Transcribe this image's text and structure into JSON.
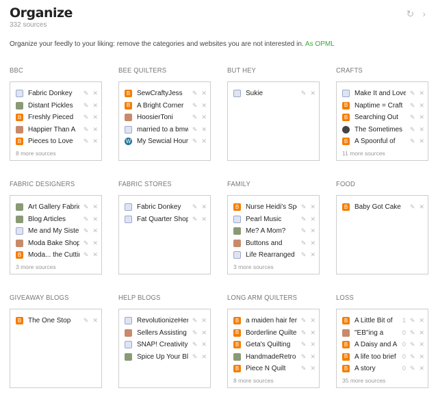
{
  "header": {
    "title": "Organize",
    "count": "332 sources"
  },
  "intro": {
    "text": "Organize your feedly to your liking: remove the categories and websites you are not interested in.",
    "opml": "As OPML"
  },
  "icons": {
    "refresh": "refresh-icon",
    "next": "chevron-right-icon"
  },
  "categories": [
    {
      "name": "BBC",
      "sources": [
        {
          "name": "Fabric Donkey",
          "icon": "generic"
        },
        {
          "name": "Distant Pickles",
          "icon": "img"
        },
        {
          "name": "Freshly Pieced",
          "icon": "blogger"
        },
        {
          "name": "Happier Than A",
          "icon": "img2"
        },
        {
          "name": "Pieces to Love",
          "icon": "blogger"
        }
      ],
      "more": "8 more sources"
    },
    {
      "name": "BEE QUILTERS",
      "sources": [
        {
          "name": "SewCraftyJess",
          "icon": "blogger"
        },
        {
          "name": "A Bright Corner",
          "icon": "blogger"
        },
        {
          "name": "HoosierToni",
          "icon": "img2"
        },
        {
          "name": "married to a bmw",
          "icon": "generic"
        },
        {
          "name": "My Sewcial Hour",
          "icon": "wp"
        }
      ],
      "more": ""
    },
    {
      "name": "BUT HEY",
      "sources": [
        {
          "name": "Sukie",
          "icon": "generic"
        }
      ],
      "more": ""
    },
    {
      "name": "CRAFTS",
      "sources": [
        {
          "name": "Make It and Love It",
          "icon": "generic"
        },
        {
          "name": "Naptime = Craft",
          "icon": "blogger"
        },
        {
          "name": "Searching Out",
          "icon": "blogger"
        },
        {
          "name": "The Sometimes",
          "icon": "dark"
        },
        {
          "name": "A Spoonful of",
          "icon": "blogger"
        }
      ],
      "more": "11 more sources"
    },
    {
      "name": "FABRIC DESIGNERS",
      "sources": [
        {
          "name": "Art Gallery Fabrics",
          "icon": "img"
        },
        {
          "name": "Blog Articles",
          "icon": "img"
        },
        {
          "name": "Me and My Sister",
          "icon": "generic"
        },
        {
          "name": "Moda Bake Shop",
          "icon": "img2"
        },
        {
          "name": "Moda... the Cutting",
          "icon": "blogger"
        }
      ],
      "more": "3 more sources"
    },
    {
      "name": "FABRIC STORES",
      "sources": [
        {
          "name": "Fabric Donkey",
          "icon": "generic"
        },
        {
          "name": "Fat Quarter Shop's",
          "icon": "generic"
        }
      ],
      "more": ""
    },
    {
      "name": "FAMILY",
      "sources": [
        {
          "name": "Nurse Heidi's Spot",
          "icon": "blogger"
        },
        {
          "name": "Pearl Music",
          "icon": "generic"
        },
        {
          "name": "Me? A Mom?",
          "icon": "img"
        },
        {
          "name": "Buttons and",
          "icon": "img2"
        },
        {
          "name": "Life Rearranged",
          "icon": "generic"
        }
      ],
      "more": "3 more sources"
    },
    {
      "name": "FOOD",
      "sources": [
        {
          "name": "Baby Got Cake",
          "icon": "blogger"
        }
      ],
      "more": ""
    },
    {
      "name": "GIVEAWAY BLOGS",
      "sources": [
        {
          "name": "The One Stop",
          "icon": "blogger"
        }
      ],
      "more": ""
    },
    {
      "name": "HELP BLOGS",
      "sources": [
        {
          "name": "RevolutionizeHer",
          "icon": "generic"
        },
        {
          "name": "Sellers Assisting",
          "icon": "img2"
        },
        {
          "name": "SNAP! Creativity",
          "icon": "generic"
        },
        {
          "name": "Spice Up Your Blog",
          "icon": "img"
        }
      ],
      "more": ""
    },
    {
      "name": "LONG ARM QUILTERS",
      "sources": [
        {
          "name": "a maiden hair fern",
          "icon": "blogger"
        },
        {
          "name": "Borderline Quilter",
          "icon": "blogger"
        },
        {
          "name": "Geta's Quilting",
          "icon": "blogger"
        },
        {
          "name": "HandmadeRetro",
          "icon": "img"
        },
        {
          "name": "Piece N Quilt",
          "icon": "blogger"
        }
      ],
      "more": "8 more sources"
    },
    {
      "name": "LOSS",
      "sources": [
        {
          "name": "A Little Bit of",
          "icon": "blogger",
          "count": "1"
        },
        {
          "name": "\"EB\"ing a",
          "icon": "img2",
          "count": "0"
        },
        {
          "name": "A Daisy and A",
          "icon": "blogger",
          "count": "0"
        },
        {
          "name": "A life too brief",
          "icon": "blogger",
          "count": "0"
        },
        {
          "name": "A story",
          "icon": "blogger",
          "count": "0"
        }
      ],
      "more": "35 more sources"
    }
  ]
}
